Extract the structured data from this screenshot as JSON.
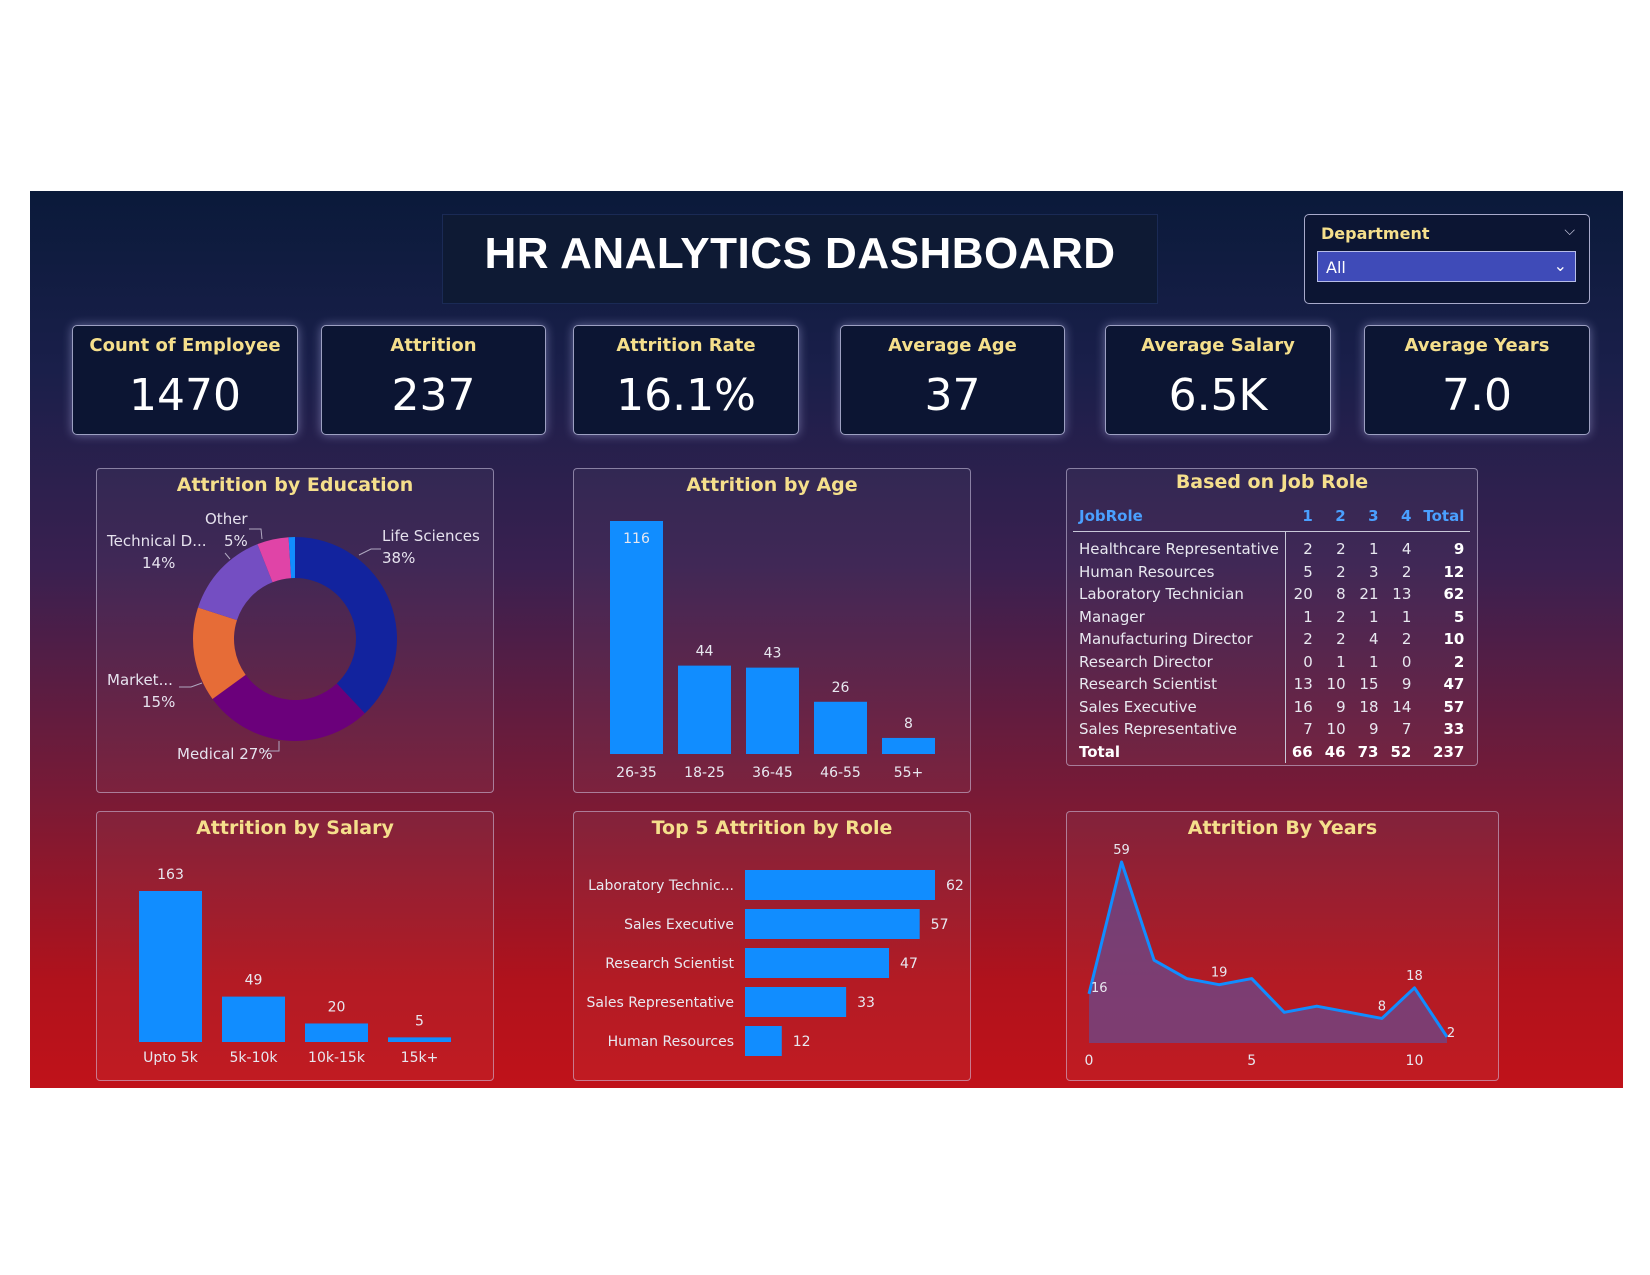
{
  "title": "HR ANALYTICS DASHBOARD",
  "slicer": {
    "label": "Department",
    "value": "All"
  },
  "kpis": [
    {
      "label": "Count of Employee",
      "value": "1470"
    },
    {
      "label": "Attrition",
      "value": "237"
    },
    {
      "label": "Attrition Rate",
      "value": "16.1%"
    },
    {
      "label": "Average Age",
      "value": "37"
    },
    {
      "label": "Average Salary",
      "value": "6.5K"
    },
    {
      "label": "Average Years",
      "value": "7.0"
    }
  ],
  "colors": {
    "bar": "#118dff",
    "donut": [
      "#12239e",
      "#6b007b",
      "#e66c37",
      "#744ec2",
      "#e044a7",
      "#118dff"
    ],
    "area_line": "#118dff",
    "area_fill": "#6a4a8c"
  },
  "chart_data": [
    {
      "type": "pie",
      "title": "Attrition by Education",
      "slices": [
        {
          "label": "Life Sciences",
          "pct_label": "38%",
          "value": 38
        },
        {
          "label": "Medical",
          "pct_label": "27%",
          "value": 27
        },
        {
          "label": "Market...",
          "pct_label": "15%",
          "value": 15
        },
        {
          "label": "Technical D...",
          "pct_label": "14%",
          "value": 14
        },
        {
          "label": "Other",
          "pct_label": "5%",
          "value": 5
        },
        {
          "label": "",
          "pct_label": "",
          "value": 1
        }
      ]
    },
    {
      "type": "bar",
      "title": "Attrition by Age",
      "categories": [
        "26-35",
        "18-25",
        "36-45",
        "46-55",
        "55+"
      ],
      "values": [
        116,
        44,
        43,
        26,
        8
      ],
      "ylim": [
        0,
        116
      ]
    },
    {
      "type": "table",
      "title": "Based on Job Role",
      "columns": [
        "JobRole",
        "1",
        "2",
        "3",
        "4",
        "Total"
      ],
      "rows": [
        [
          "Healthcare Representative",
          2,
          2,
          1,
          4,
          9
        ],
        [
          "Human Resources",
          5,
          2,
          3,
          2,
          12
        ],
        [
          "Laboratory Technician",
          20,
          8,
          21,
          13,
          62
        ],
        [
          "Manager",
          1,
          2,
          1,
          1,
          5
        ],
        [
          "Manufacturing Director",
          2,
          2,
          4,
          2,
          10
        ],
        [
          "Research Director",
          0,
          1,
          1,
          0,
          2
        ],
        [
          "Research Scientist",
          13,
          10,
          15,
          9,
          47
        ],
        [
          "Sales Executive",
          16,
          9,
          18,
          14,
          57
        ],
        [
          "Sales Representative",
          7,
          10,
          9,
          7,
          33
        ]
      ],
      "total_row": [
        "Total",
        66,
        46,
        73,
        52,
        237
      ]
    },
    {
      "type": "bar",
      "title": "Attrition by Salary",
      "categories": [
        "Upto 5k",
        "5k-10k",
        "10k-15k",
        "15k+"
      ],
      "values": [
        163,
        49,
        20,
        5
      ],
      "ylim": [
        0,
        163
      ]
    },
    {
      "type": "bar",
      "orientation": "horizontal",
      "title": "Top 5 Attrition by Role",
      "categories": [
        "Laboratory Technic...",
        "Sales Executive",
        "Research Scientist",
        "Sales Representative",
        "Human Resources"
      ],
      "values": [
        62,
        57,
        47,
        33,
        12
      ],
      "xlim": [
        0,
        62
      ]
    },
    {
      "type": "area",
      "title": "Attrition By Years",
      "x": [
        0,
        1,
        2,
        3,
        4,
        5,
        6,
        7,
        8,
        9,
        10,
        11
      ],
      "y": [
        16,
        59,
        27,
        21,
        19,
        21,
        10,
        12,
        10,
        8,
        18,
        2
      ],
      "labeled_points": [
        0,
        1,
        4,
        9,
        10,
        11
      ],
      "xticks": [
        0,
        5,
        10
      ],
      "xlim": [
        0,
        11
      ],
      "ylim": [
        0,
        59
      ]
    }
  ]
}
